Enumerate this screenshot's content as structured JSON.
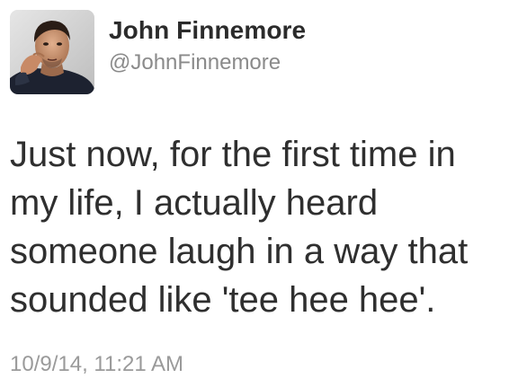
{
  "user": {
    "display_name": "John Finnemore",
    "handle": "@JohnFinnemore",
    "avatar_icon": "profile-photo"
  },
  "tweet": {
    "text": "Just now, for the first time in\nmy life, I actually heard\nsomeone laugh in a way that\nsounded like 'tee hee hee'.",
    "timestamp": "10/9/14, 11:21 AM"
  },
  "colors": {
    "name": "#2b2b2b",
    "handle": "#8a8a8a",
    "body_text": "#2f2f2f",
    "timestamp": "#9a9a9a",
    "background": "#ffffff"
  }
}
